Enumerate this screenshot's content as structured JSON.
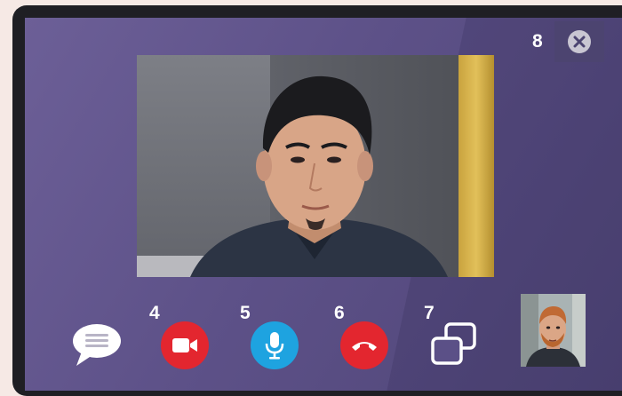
{
  "markers": {
    "close_marker": "8",
    "camera_marker": "4",
    "mic_marker": "5",
    "hangup_marker": "6",
    "switch_marker": "7"
  },
  "icons": {
    "chat": "speech-bubble-icon",
    "camera": "video-camera-icon",
    "microphone": "microphone-icon",
    "hangup": "phone-hangup-icon",
    "switch": "switch-windows-icon",
    "close": "close-icon"
  },
  "colors": {
    "background": "#5d5188",
    "camera_button": "#e3262f",
    "mic_button": "#1ea3e0",
    "hangup_button": "#e3262f",
    "close_panel": "#4c4470"
  }
}
